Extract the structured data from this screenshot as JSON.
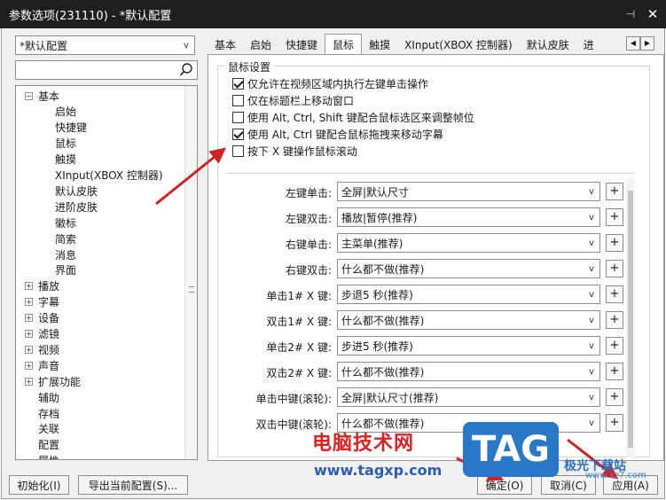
{
  "window": {
    "title": "参数选项(231110) - *默认配置",
    "pin_glyph": "⊣",
    "close_glyph": "✕"
  },
  "config_select": {
    "value": "*默认配置"
  },
  "search": {
    "placeholder": ""
  },
  "tree": {
    "items": [
      {
        "label": "基本",
        "level": 0,
        "toggle": "−"
      },
      {
        "label": "启始",
        "level": 1
      },
      {
        "label": "快捷键",
        "level": 1
      },
      {
        "label": "鼠标",
        "level": 1
      },
      {
        "label": "触摸",
        "level": 1
      },
      {
        "label": "XInput(XBOX 控制器)",
        "level": 1
      },
      {
        "label": "默认皮肤",
        "level": 1
      },
      {
        "label": "进阶皮肤",
        "level": 1
      },
      {
        "label": "徽标",
        "level": 1
      },
      {
        "label": "简索",
        "level": 1
      },
      {
        "label": "消息",
        "level": 1
      },
      {
        "label": "界面",
        "level": 1
      },
      {
        "label": "播放",
        "level": 0,
        "toggle": "+"
      },
      {
        "label": "字幕",
        "level": 0,
        "toggle": "+"
      },
      {
        "label": "设备",
        "level": 0,
        "toggle": "+"
      },
      {
        "label": "滤镜",
        "level": 0,
        "toggle": "+"
      },
      {
        "label": "视频",
        "level": 0,
        "toggle": "+"
      },
      {
        "label": "声音",
        "level": 0,
        "toggle": "+"
      },
      {
        "label": "扩展功能",
        "level": 0,
        "toggle": "+"
      },
      {
        "label": "辅助",
        "level": 0
      },
      {
        "label": "存档",
        "level": 0
      },
      {
        "label": "关联",
        "level": 0
      },
      {
        "label": "配置",
        "level": 0
      },
      {
        "label": "属性",
        "level": 0
      }
    ]
  },
  "tabs": [
    {
      "label": "基本",
      "active": false
    },
    {
      "label": "启始",
      "active": false
    },
    {
      "label": "快捷键",
      "active": false
    },
    {
      "label": "鼠标",
      "active": true
    },
    {
      "label": "触摸",
      "active": false
    },
    {
      "label": "XInput(XBOX 控制器)",
      "active": false
    },
    {
      "label": "默认皮肤",
      "active": false
    },
    {
      "label": "进",
      "active": false
    }
  ],
  "tab_scroll": {
    "left": "◀",
    "right": "▶"
  },
  "mouse_settings": {
    "group_title": "鼠标设置",
    "checkboxes": [
      {
        "label": "仅允许在视频区域内执行左键单击操作",
        "checked": true
      },
      {
        "label": "仅在标题栏上移动窗口",
        "checked": false
      },
      {
        "label": "使用 Alt, Ctrl, Shift 键配合鼠标选区来调整帧位",
        "checked": false
      },
      {
        "label": "使用 Alt, Ctrl 键配合鼠标拖拽来移动字幕",
        "checked": true
      },
      {
        "label": "按下 X 键操作鼠标滚动",
        "checked": false
      }
    ],
    "actions": [
      {
        "label": "左键单击:",
        "value": "全屏|默认尺寸"
      },
      {
        "label": "左键双击:",
        "value": "播放|暂停(推荐)"
      },
      {
        "label": "右键单击:",
        "value": "主菜单(推荐)"
      },
      {
        "label": "右键双击:",
        "value": "什么都不做(推荐)"
      },
      {
        "label": "单击1# X 键:",
        "value": "步退5 秒(推荐)"
      },
      {
        "label": "双击1# X 键:",
        "value": "什么都不做(推荐)"
      },
      {
        "label": "单击2# X 键:",
        "value": "步进5 秒(推荐)"
      },
      {
        "label": "双击2# X 键:",
        "value": "什么都不做(推荐)"
      },
      {
        "label": "单击中键(滚轮):",
        "value": "全屏|默认尺寸(推荐)"
      },
      {
        "label": "双击中键(滚轮):",
        "value": "什么都不做(推荐)"
      }
    ],
    "dropdown_arrow": "v",
    "plus_label": "+"
  },
  "buttons": {
    "init": "初始化(I)",
    "export": "导出当前配置(S)...",
    "ok": "确定(O)",
    "cancel": "取消(C)",
    "apply": "应用(A)"
  },
  "watermark": {
    "site_name": "电脑技术网",
    "site_url": "www.tagxp.com",
    "tag": "TAG",
    "download_name": "极光下载站",
    "download_url": "www.xz7.com"
  },
  "colors": {
    "titlebar": "#1f1f1f",
    "annotation_arrow": "#d42020",
    "watermark_red": "#e02020",
    "watermark_blue": "#2877c9"
  }
}
